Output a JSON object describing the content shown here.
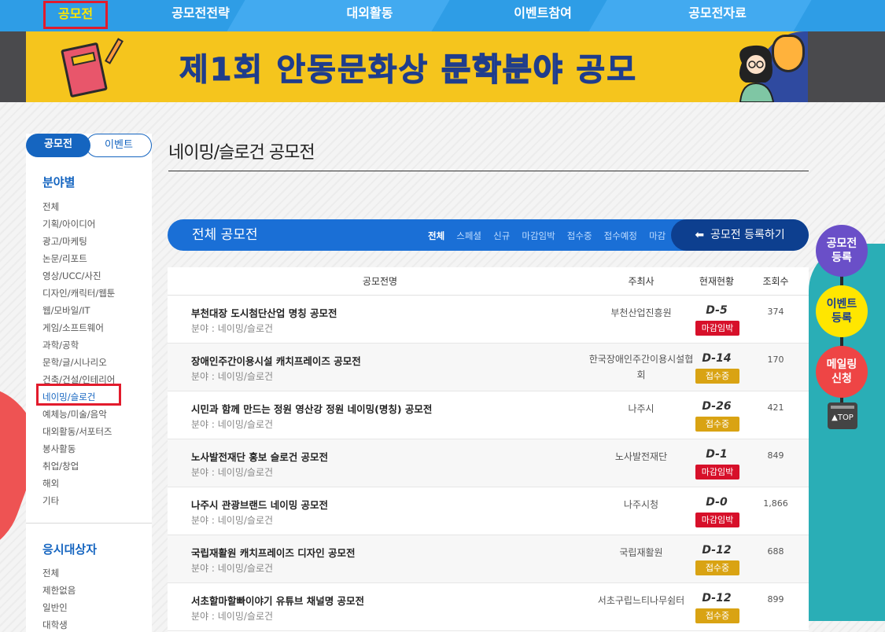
{
  "nav": {
    "items": [
      "공모전",
      "공모전전략",
      "대외활동",
      "이벤트참여",
      "공모전자료"
    ]
  },
  "banner": {
    "title_part1": "제1회 안동문화상 ",
    "title_part2": "문학분야",
    "title_part3": " 공모"
  },
  "sidebar": {
    "tab_active": "공모전",
    "tab_inactive": "이벤트",
    "section1_title": "분야별",
    "categories": [
      "전체",
      "기획/아이디어",
      "광고/마케팅",
      "논문/리포트",
      "영상/UCC/사진",
      "디자인/캐릭터/웹툰",
      "웹/모바일/IT",
      "게임/소프트웨어",
      "과학/공학",
      "문학/글/시나리오",
      "건축/건설/인테리어",
      "네이밍/슬로건",
      "예체능/미술/음악",
      "대외활동/서포터즈",
      "봉사활동",
      "취업/창업",
      "해외",
      "기타"
    ],
    "section2_title": "응시대상자",
    "targets": [
      "전체",
      "제한없음",
      "일반인",
      "대학생"
    ]
  },
  "main": {
    "page_title": "네이밍/슬로건 공모전",
    "bar_title": "전체 공모전",
    "filters": [
      "전체",
      "스페셜",
      "신규",
      "마감임박",
      "접수중",
      "접수예정",
      "마감"
    ],
    "register_label": "공모전 등록하기"
  },
  "table": {
    "headers": [
      "공모전명",
      "주최사",
      "현재현황",
      "조회수"
    ],
    "rows": [
      {
        "title": "부천대장 도시첨단산업 명칭 공모전",
        "field": "분야 : 네이밍/슬로건",
        "org": "부천산업진흥원",
        "dday": "D-5",
        "status": "마감임박",
        "views": "374"
      },
      {
        "title": "장애인주간이용시설 캐치프레이즈 공모전",
        "field": "분야 : 네이밍/슬로건",
        "org": "한국장애인주간이용시설협회",
        "dday": "D-14",
        "status": "접수중",
        "views": "170"
      },
      {
        "title": "시민과 함께 만드는 정원 영산강 정원 네이밍(명칭) 공모전",
        "field": "분야 : 네이밍/슬로건",
        "org": "나주시",
        "dday": "D-26",
        "status": "접수중",
        "views": "421"
      },
      {
        "title": "노사발전재단 홍보 슬로건 공모전",
        "field": "분야 : 네이밍/슬로건",
        "org": "노사발전재단",
        "dday": "D-1",
        "status": "마감임박",
        "views": "849"
      },
      {
        "title": "나주시 관광브랜드 네이밍 공모전",
        "field": "분야 : 네이밍/슬로건",
        "org": "나주시청",
        "dday": "D-0",
        "status": "마감임박",
        "views": "1,866"
      },
      {
        "title": "국립재활원 캐치프레이즈 디자인 공모전",
        "field": "분야 : 네이밍/슬로건",
        "org": "국립재활원",
        "dday": "D-12",
        "status": "접수중",
        "views": "688"
      },
      {
        "title": "서초할마할빠이야기 유튜브 채널명 공모전",
        "field": "분야 : 네이밍/슬로건",
        "org": "서초구립느티나무쉼터",
        "dday": "D-12",
        "status": "접수중",
        "views": "899"
      }
    ]
  },
  "floating": {
    "register": "공모전\n등록",
    "event": "이벤트\n등록",
    "mailing": "메일링\n신청",
    "top": "▲TOP"
  },
  "colors": {
    "primary_blue": "#1a6fd6",
    "nav_blue": "#2e9de6",
    "badge_red": "#d7102a",
    "badge_gold": "#d9a313",
    "banner_yellow": "#f5c51d"
  }
}
